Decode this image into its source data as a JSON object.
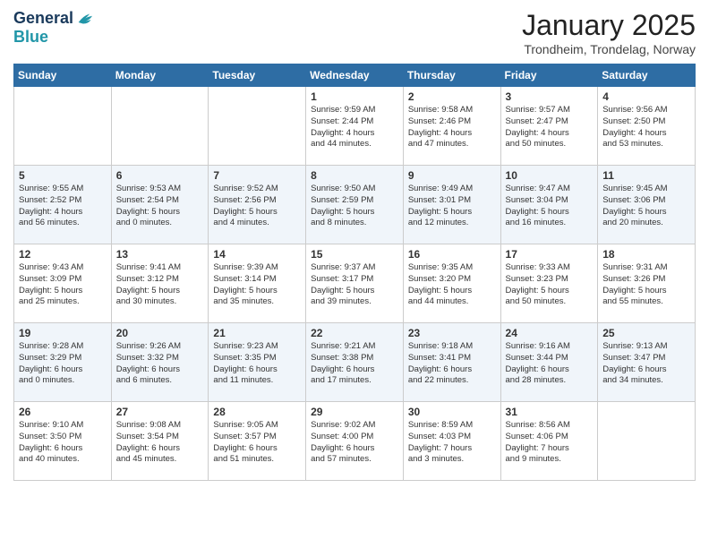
{
  "header": {
    "logo_line1": "General",
    "logo_line2": "Blue",
    "month_title": "January 2025",
    "location": "Trondheim, Trondelag, Norway"
  },
  "weekdays": [
    "Sunday",
    "Monday",
    "Tuesday",
    "Wednesday",
    "Thursday",
    "Friday",
    "Saturday"
  ],
  "weeks": [
    [
      {
        "day": "",
        "info": ""
      },
      {
        "day": "",
        "info": ""
      },
      {
        "day": "",
        "info": ""
      },
      {
        "day": "1",
        "info": "Sunrise: 9:59 AM\nSunset: 2:44 PM\nDaylight: 4 hours\nand 44 minutes."
      },
      {
        "day": "2",
        "info": "Sunrise: 9:58 AM\nSunset: 2:46 PM\nDaylight: 4 hours\nand 47 minutes."
      },
      {
        "day": "3",
        "info": "Sunrise: 9:57 AM\nSunset: 2:47 PM\nDaylight: 4 hours\nand 50 minutes."
      },
      {
        "day": "4",
        "info": "Sunrise: 9:56 AM\nSunset: 2:50 PM\nDaylight: 4 hours\nand 53 minutes."
      }
    ],
    [
      {
        "day": "5",
        "info": "Sunrise: 9:55 AM\nSunset: 2:52 PM\nDaylight: 4 hours\nand 56 minutes."
      },
      {
        "day": "6",
        "info": "Sunrise: 9:53 AM\nSunset: 2:54 PM\nDaylight: 5 hours\nand 0 minutes."
      },
      {
        "day": "7",
        "info": "Sunrise: 9:52 AM\nSunset: 2:56 PM\nDaylight: 5 hours\nand 4 minutes."
      },
      {
        "day": "8",
        "info": "Sunrise: 9:50 AM\nSunset: 2:59 PM\nDaylight: 5 hours\nand 8 minutes."
      },
      {
        "day": "9",
        "info": "Sunrise: 9:49 AM\nSunset: 3:01 PM\nDaylight: 5 hours\nand 12 minutes."
      },
      {
        "day": "10",
        "info": "Sunrise: 9:47 AM\nSunset: 3:04 PM\nDaylight: 5 hours\nand 16 minutes."
      },
      {
        "day": "11",
        "info": "Sunrise: 9:45 AM\nSunset: 3:06 PM\nDaylight: 5 hours\nand 20 minutes."
      }
    ],
    [
      {
        "day": "12",
        "info": "Sunrise: 9:43 AM\nSunset: 3:09 PM\nDaylight: 5 hours\nand 25 minutes."
      },
      {
        "day": "13",
        "info": "Sunrise: 9:41 AM\nSunset: 3:12 PM\nDaylight: 5 hours\nand 30 minutes."
      },
      {
        "day": "14",
        "info": "Sunrise: 9:39 AM\nSunset: 3:14 PM\nDaylight: 5 hours\nand 35 minutes."
      },
      {
        "day": "15",
        "info": "Sunrise: 9:37 AM\nSunset: 3:17 PM\nDaylight: 5 hours\nand 39 minutes."
      },
      {
        "day": "16",
        "info": "Sunrise: 9:35 AM\nSunset: 3:20 PM\nDaylight: 5 hours\nand 44 minutes."
      },
      {
        "day": "17",
        "info": "Sunrise: 9:33 AM\nSunset: 3:23 PM\nDaylight: 5 hours\nand 50 minutes."
      },
      {
        "day": "18",
        "info": "Sunrise: 9:31 AM\nSunset: 3:26 PM\nDaylight: 5 hours\nand 55 minutes."
      }
    ],
    [
      {
        "day": "19",
        "info": "Sunrise: 9:28 AM\nSunset: 3:29 PM\nDaylight: 6 hours\nand 0 minutes."
      },
      {
        "day": "20",
        "info": "Sunrise: 9:26 AM\nSunset: 3:32 PM\nDaylight: 6 hours\nand 6 minutes."
      },
      {
        "day": "21",
        "info": "Sunrise: 9:23 AM\nSunset: 3:35 PM\nDaylight: 6 hours\nand 11 minutes."
      },
      {
        "day": "22",
        "info": "Sunrise: 9:21 AM\nSunset: 3:38 PM\nDaylight: 6 hours\nand 17 minutes."
      },
      {
        "day": "23",
        "info": "Sunrise: 9:18 AM\nSunset: 3:41 PM\nDaylight: 6 hours\nand 22 minutes."
      },
      {
        "day": "24",
        "info": "Sunrise: 9:16 AM\nSunset: 3:44 PM\nDaylight: 6 hours\nand 28 minutes."
      },
      {
        "day": "25",
        "info": "Sunrise: 9:13 AM\nSunset: 3:47 PM\nDaylight: 6 hours\nand 34 minutes."
      }
    ],
    [
      {
        "day": "26",
        "info": "Sunrise: 9:10 AM\nSunset: 3:50 PM\nDaylight: 6 hours\nand 40 minutes."
      },
      {
        "day": "27",
        "info": "Sunrise: 9:08 AM\nSunset: 3:54 PM\nDaylight: 6 hours\nand 45 minutes."
      },
      {
        "day": "28",
        "info": "Sunrise: 9:05 AM\nSunset: 3:57 PM\nDaylight: 6 hours\nand 51 minutes."
      },
      {
        "day": "29",
        "info": "Sunrise: 9:02 AM\nSunset: 4:00 PM\nDaylight: 6 hours\nand 57 minutes."
      },
      {
        "day": "30",
        "info": "Sunrise: 8:59 AM\nSunset: 4:03 PM\nDaylight: 7 hours\nand 3 minutes."
      },
      {
        "day": "31",
        "info": "Sunrise: 8:56 AM\nSunset: 4:06 PM\nDaylight: 7 hours\nand 9 minutes."
      },
      {
        "day": "",
        "info": ""
      }
    ]
  ]
}
